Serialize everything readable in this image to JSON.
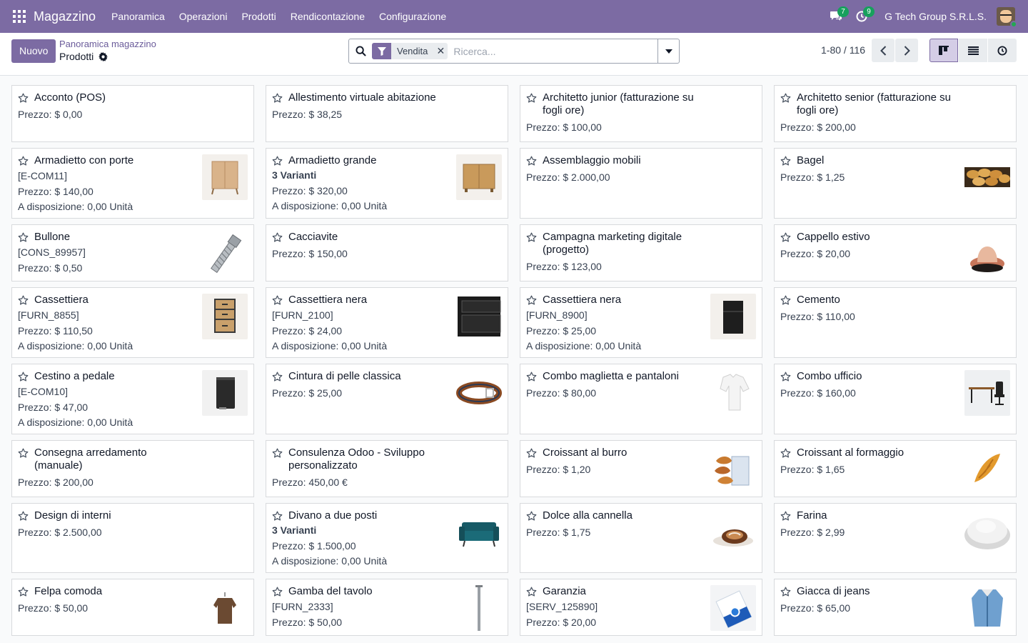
{
  "navbar": {
    "brand": "Magazzino",
    "menu": [
      "Panoramica",
      "Operazioni",
      "Prodotti",
      "Rendicontazione",
      "Configurazione"
    ],
    "messages_count": "7",
    "activities_count": "9",
    "company": "G Tech Group S.R.L.S."
  },
  "control": {
    "new_label": "Nuovo",
    "breadcrumb_parent": "Panoramica magazzino",
    "breadcrumb_current": "Prodotti",
    "facet_label": "Vendita",
    "search_placeholder": "Ricerca...",
    "pager": "1-80 / 116"
  },
  "products": [
    {
      "name": "Acconto (POS)",
      "price": "Prezzo: $ 0,00"
    },
    {
      "name": "Allestimento virtuale abitazione",
      "price": "Prezzo: $ 38,25"
    },
    {
      "name": "Architetto junior (fatturazione su fogli ore)",
      "price": "Prezzo: $ 100,00"
    },
    {
      "name": "Architetto senior (fatturazione su fogli ore)",
      "price": "Prezzo: $ 200,00"
    },
    {
      "name": "Armadietto con porte",
      "ref": "[E-COM11]",
      "price": "Prezzo: $ 140,00",
      "avail": "A disposizione: 0,00 Unità",
      "image": "cabinet-doors"
    },
    {
      "name": "Armadietto grande",
      "variants": "3 Varianti",
      "price": "Prezzo: $ 320,00",
      "avail": "A disposizione: 0,00 Unità",
      "image": "cabinet-large"
    },
    {
      "name": "Assemblaggio mobili",
      "price": "Prezzo: $ 2.000,00"
    },
    {
      "name": "Bagel",
      "price": "Prezzo: $ 1,25",
      "image": "bagel"
    },
    {
      "name": "Bullone",
      "ref": "[CONS_89957]",
      "price": "Prezzo: $ 0,50",
      "image": "bolt"
    },
    {
      "name": "Cacciavite",
      "price": "Prezzo: $ 150,00"
    },
    {
      "name": "Campagna marketing digitale (progetto)",
      "price": "Prezzo: $ 123,00"
    },
    {
      "name": "Cappello estivo",
      "price": "Prezzo: $ 20,00",
      "image": "hat"
    },
    {
      "name": "Cassettiera",
      "ref": "[FURN_8855]",
      "price": "Prezzo: $ 110,50",
      "avail": "A disposizione: 0,00 Unità",
      "image": "drawer-wood"
    },
    {
      "name": "Cassettiera nera",
      "ref": "[FURN_2100]",
      "price": "Prezzo: $ 24,00",
      "avail": "A disposizione: 0,00 Unità",
      "image": "drawer-black"
    },
    {
      "name": "Cassettiera nera",
      "ref": "[FURN_8900]",
      "price": "Prezzo: $ 25,00",
      "avail": "A disposizione: 0,00 Unità",
      "image": "drawer-black-small"
    },
    {
      "name": "Cemento",
      "price": "Prezzo: $ 110,00"
    },
    {
      "name": "Cestino a pedale",
      "ref": "[E-COM10]",
      "price": "Prezzo: $ 47,00",
      "avail": "A disposizione: 0,00 Unità",
      "image": "bin"
    },
    {
      "name": "Cintura di pelle classica",
      "price": "Prezzo: $ 25,00",
      "image": "belt"
    },
    {
      "name": "Combo maglietta e pantaloni",
      "price": "Prezzo: $ 80,00",
      "image": "shirt"
    },
    {
      "name": "Combo ufficio",
      "price": "Prezzo: $ 160,00",
      "image": "office"
    },
    {
      "name": "Consegna arredamento (manuale)",
      "price": "Prezzo: $ 200,00"
    },
    {
      "name": "Consulenza Odoo - Sviluppo personalizzato",
      "price": "Prezzo: 450,00 €"
    },
    {
      "name": "Croissant al burro",
      "price": "Prezzo: $ 1,20",
      "image": "croissants"
    },
    {
      "name": "Croissant al formaggio",
      "price": "Prezzo: $ 1,65",
      "image": "croissant"
    },
    {
      "name": "Design di interni",
      "price": "Prezzo: $ 2.500,00"
    },
    {
      "name": "Divano a due posti",
      "variants": "3 Varianti",
      "price": "Prezzo: $ 1.500,00",
      "avail": "A disposizione: 0,00 Unità",
      "image": "sofa"
    },
    {
      "name": "Dolce alla cannella",
      "price": "Prezzo: $ 1,75",
      "image": "cinnamon"
    },
    {
      "name": "Farina",
      "price": "Prezzo: $ 2,99",
      "image": "flour"
    },
    {
      "name": "Felpa comoda",
      "price": "Prezzo: $ 50,00",
      "image": "sweater"
    },
    {
      "name": "Gamba del tavolo",
      "ref": "[FURN_2333]",
      "price": "Prezzo: $ 50,00",
      "image": "table-leg"
    },
    {
      "name": "Garanzia",
      "ref": "[SERV_125890]",
      "price": "Prezzo: $ 20,00",
      "image": "warranty"
    },
    {
      "name": "Giacca di jeans",
      "price": "Prezzo: $ 65,00",
      "image": "jacket"
    }
  ]
}
